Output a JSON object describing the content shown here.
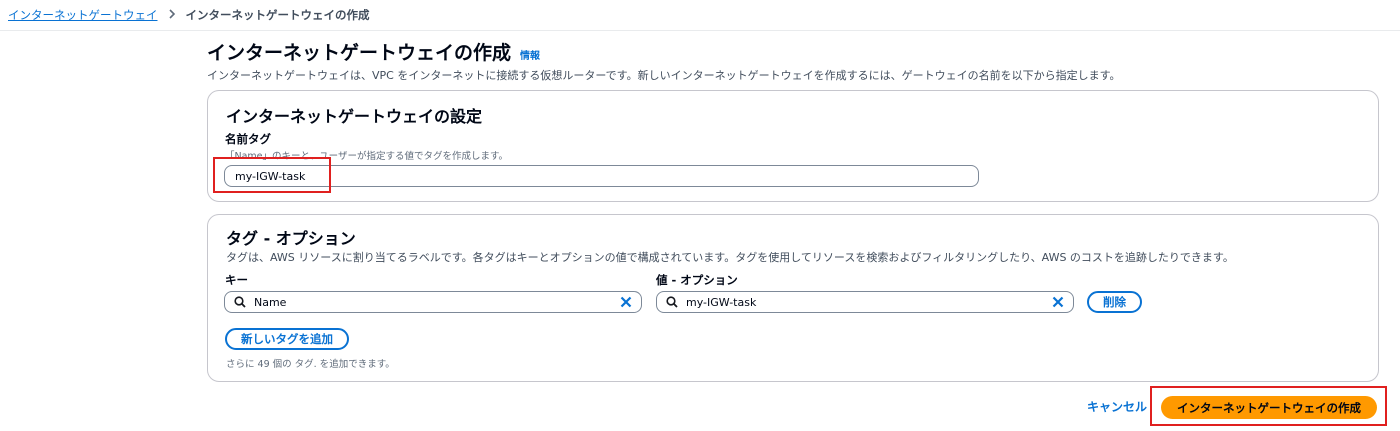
{
  "breadcrumb": {
    "parent": "インターネットゲートウェイ",
    "current": "インターネットゲートウェイの作成"
  },
  "header": {
    "title": "インターネットゲートウェイの作成",
    "info_label": "情報",
    "description": "インターネットゲートウェイは、VPC をインターネットに接続する仮想ルーターです。新しいインターネットゲートウェイを作成するには、ゲートウェイの名前を以下から指定します。"
  },
  "settings": {
    "title": "インターネットゲートウェイの設定",
    "name_tag_label": "名前タグ",
    "name_tag_hint": "「Name」のキーと、ユーザーが指定する値でタグを作成します。",
    "name_tag_value": "my-IGW-task"
  },
  "tags": {
    "title": "タグ - オプション",
    "description": "タグは、AWS リソースに割り当てるラベルです。各タグはキーとオプションの値で構成されています。タグを使用してリソースを検索およびフィルタリングしたり、AWS のコストを追跡したりできます。",
    "key_label": "キー",
    "value_label": "値 - オプション",
    "rows": [
      {
        "key": "Name",
        "value": "my-IGW-task"
      }
    ],
    "remove_label": "削除",
    "add_label": "新しいタグを追加",
    "limit_text": "さらに 49 個の タグ. を追加できます。"
  },
  "footer": {
    "cancel_label": "キャンセル",
    "create_label": "インターネットゲートウェイの作成"
  },
  "colors": {
    "link": "#0972d3",
    "primary": "#ff9900",
    "highlight": "#e0201f"
  },
  "icons": [
    "chevron-right-icon",
    "search-icon",
    "clear-icon"
  ]
}
